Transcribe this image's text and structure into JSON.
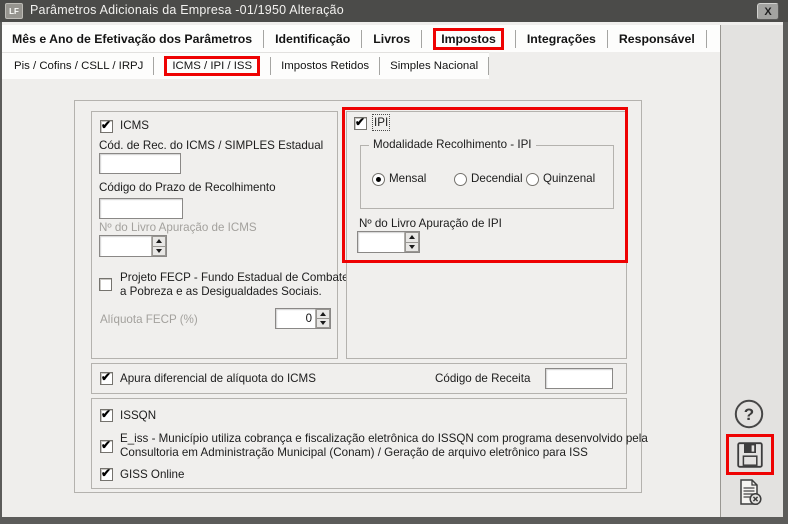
{
  "colors": {
    "titlebar": "#4b4b49",
    "highlight_red": "#ee0202",
    "panel_bg": "#f0efed",
    "side_column_bg": "#e3e2e0",
    "disabled_text": "#a3a19d"
  },
  "window": {
    "title": "Parâmetros Adicionais da Empresa -01/1950 Alteração",
    "app_icon_label": "LF",
    "close_label": "X"
  },
  "tabs_primary": {
    "items": [
      {
        "label": "Mês e Ano de Efetivação dos Parâmetros",
        "highlighted": false
      },
      {
        "label": "Identificação",
        "highlighted": false
      },
      {
        "label": "Livros",
        "highlighted": false
      },
      {
        "label": "Impostos",
        "highlighted": true
      },
      {
        "label": "Integrações",
        "highlighted": false
      },
      {
        "label": "Responsável",
        "highlighted": false
      }
    ]
  },
  "tabs_secondary": {
    "items": [
      {
        "label": "Pis / Cofins / CSLL / IRPJ",
        "highlighted": false
      },
      {
        "label": "ICMS / IPI / ISS",
        "highlighted": true
      },
      {
        "label": "Impostos Retidos",
        "highlighted": false
      },
      {
        "label": "Simples Nacional",
        "highlighted": false
      }
    ]
  },
  "icms_panel": {
    "checkbox_label": "ICMS",
    "checked": true,
    "cod_rec_label": "Cód. de Rec. do ICMS / SIMPLES Estadual",
    "cod_rec_value": "",
    "prazo_label": "Código do Prazo de Recolhimento",
    "prazo_value": "",
    "livro_label": "Nº do Livro Apuração de ICMS",
    "livro_value": "",
    "fecp_label_line1": "Projeto FECP - Fundo Estadual de Combate",
    "fecp_label_line2": "a Pobreza e as Desigualdades Sociais.",
    "fecp_checked": false,
    "aliquota_label": "Alíquota FECP (%)",
    "aliquota_value": "0"
  },
  "ipi_panel": {
    "checkbox_label": "IPI",
    "checked": true,
    "modalidade_legend": "Modalidade Recolhimento - IPI",
    "options": [
      {
        "label": "Mensal",
        "selected": true
      },
      {
        "label": "Decendial",
        "selected": false
      },
      {
        "label": "Quinzenal",
        "selected": false
      }
    ],
    "livro_label": "Nº do Livro Apuração de IPI",
    "livro_value": ""
  },
  "diferencial_row": {
    "checkbox_label": "Apura diferencial de alíquota do ICMS",
    "checked": true,
    "codigo_receita_label": "Código de Receita",
    "codigo_receita_value": ""
  },
  "issqn_panel": {
    "issqn_label": "ISSQN",
    "issqn_checked": true,
    "eiss_line1": "E_iss - Município utiliza cobrança e fiscalização eletrônica do ISSQN com programa desenvolvido pela",
    "eiss_line2": "Consultoria em Administração Municipal (Conam) / Geração de arquivo eletrônico para ISS",
    "eiss_checked": true,
    "giss_label": "GISS Online",
    "giss_checked": true
  },
  "side_buttons": {
    "help_symbol": "?",
    "save_icon": "floppy-disk",
    "cancel_icon": "document-x"
  }
}
